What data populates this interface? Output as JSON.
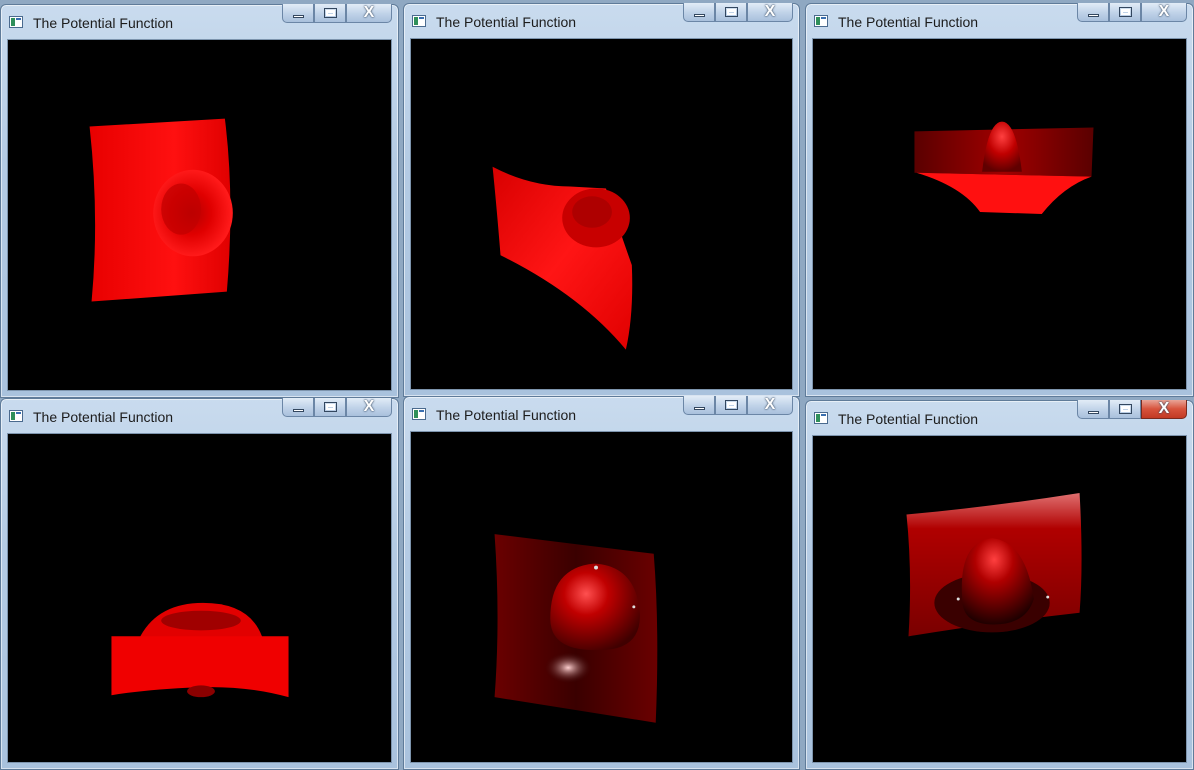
{
  "windows": [
    {
      "title": "The Potential Function"
    },
    {
      "title": "The Potential Function"
    },
    {
      "title": "The Potential Function"
    },
    {
      "title": "The Potential Function"
    },
    {
      "title": "The Potential Function"
    },
    {
      "title": "The Potential Function"
    }
  ],
  "controls": {
    "minimize": "—",
    "close": "X"
  },
  "colors": {
    "surface": "#ff1a1a",
    "background": "#000000",
    "titlebar": "#b4cbe4",
    "close_active": "#c23a24"
  }
}
